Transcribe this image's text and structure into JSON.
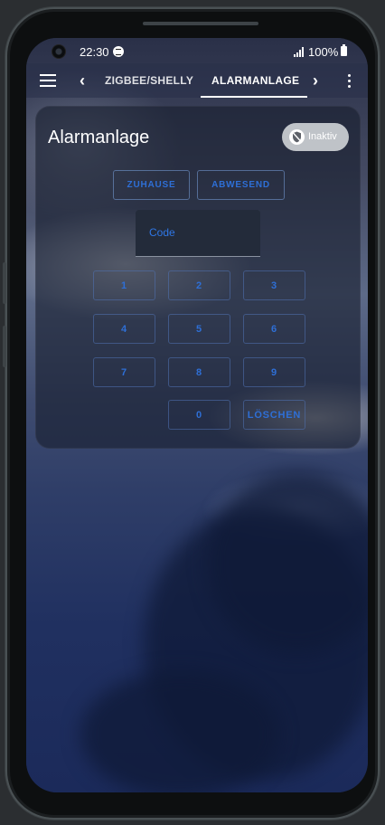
{
  "status_bar": {
    "time": "22:30",
    "battery": "100%"
  },
  "toolbar": {
    "tabs": [
      {
        "label": "ZIGBEE/SHELLY"
      },
      {
        "label": "ALARMANLAGE"
      }
    ]
  },
  "alarm_panel": {
    "title": "Alarmanlage",
    "state": "Inaktiv",
    "actions": [
      "ZUHAUSE",
      "ABWESEND"
    ],
    "code_label": "Code",
    "keypad": [
      "1",
      "2",
      "3",
      "4",
      "5",
      "6",
      "7",
      "8",
      "9",
      "0",
      "LÖSCHEN"
    ]
  },
  "colors": {
    "accent": "#2e6fd6",
    "card": "#181e2e",
    "chip": "#bfc3c8"
  }
}
